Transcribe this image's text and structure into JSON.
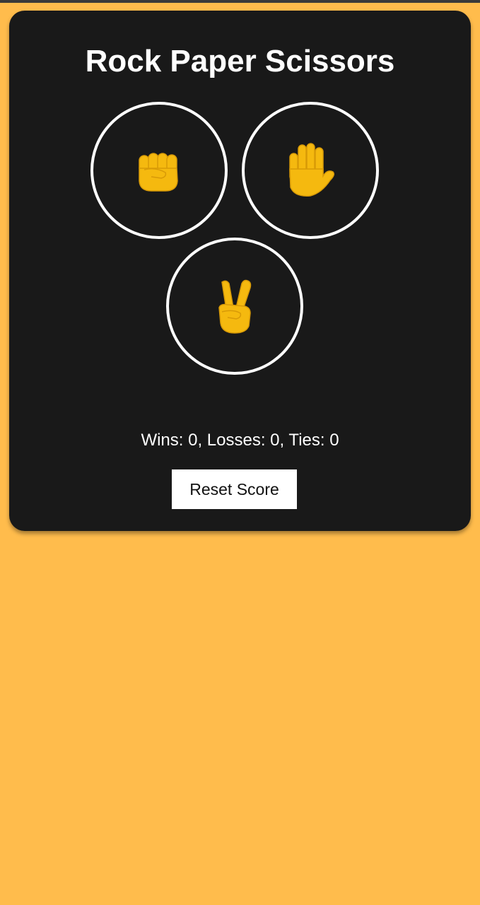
{
  "app": {
    "title": "Rock Paper Scissors"
  },
  "choices": [
    {
      "id": "rock",
      "icon": "raised-fist-icon"
    },
    {
      "id": "paper",
      "icon": "raised-hand-icon"
    },
    {
      "id": "scissors",
      "icon": "victory-hand-icon"
    }
  ],
  "score": {
    "text": "Wins: 0, Losses: 0, Ties: 0"
  },
  "reset_button": {
    "label": "Reset Score"
  },
  "colors": {
    "background": "#FFBC4C",
    "card": "#191919",
    "emoji": "#F5B90F",
    "text": "#FFFFFF"
  }
}
